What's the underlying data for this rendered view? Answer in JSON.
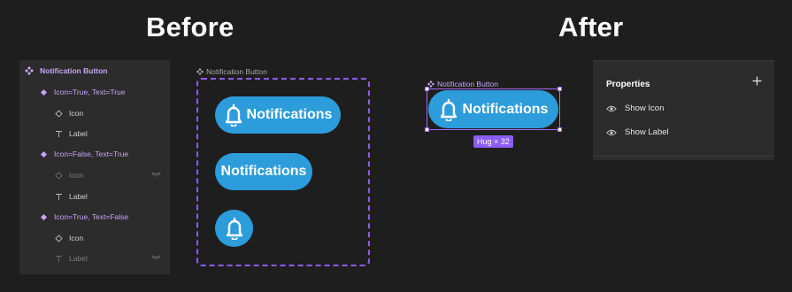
{
  "headings": {
    "before": "Before",
    "after": "After"
  },
  "layers": {
    "items": [
      {
        "label": "Notification Button",
        "icon": "component-icon",
        "level": 0
      },
      {
        "label": "Icon=True, Text=True",
        "icon": "variant-icon",
        "level": 1
      },
      {
        "label": "Icon",
        "icon": "instance-icon",
        "level": 2
      },
      {
        "label": "Label",
        "icon": "text-icon",
        "level": 2
      },
      {
        "label": "Icon=False, Text=True",
        "icon": "variant-icon",
        "level": 1
      },
      {
        "label": "Icon",
        "icon": "instance-icon",
        "level": 2,
        "hidden": true
      },
      {
        "label": "Label",
        "icon": "text-icon",
        "level": 2
      },
      {
        "label": "Icon=True, Text=False",
        "icon": "variant-icon",
        "level": 1
      },
      {
        "label": "Icon",
        "icon": "instance-icon",
        "level": 2
      },
      {
        "label": "Label",
        "icon": "text-icon",
        "level": 2,
        "hidden": true
      }
    ]
  },
  "before": {
    "frame_label": "Notification Button",
    "buttons": [
      {
        "label": "Notifications",
        "has_icon": true
      },
      {
        "label": "Notifications",
        "has_icon": false
      },
      {
        "label": "",
        "has_icon": true
      }
    ]
  },
  "after": {
    "frame_label": "Notification Button",
    "button_label": "Notifications",
    "hug_badge": "Hug × 32"
  },
  "properties": {
    "title": "Properties",
    "add_icon": "plus-icon",
    "rows": [
      {
        "label": "Show Icon",
        "icon": "eye-icon"
      },
      {
        "label": "Show Label",
        "icon": "eye-icon"
      }
    ]
  },
  "colors": {
    "background": "#1e1e1e",
    "panel": "#2c2c2c",
    "accent_purple": "#8b5cf6",
    "button_blue": "#2d9cdb"
  }
}
